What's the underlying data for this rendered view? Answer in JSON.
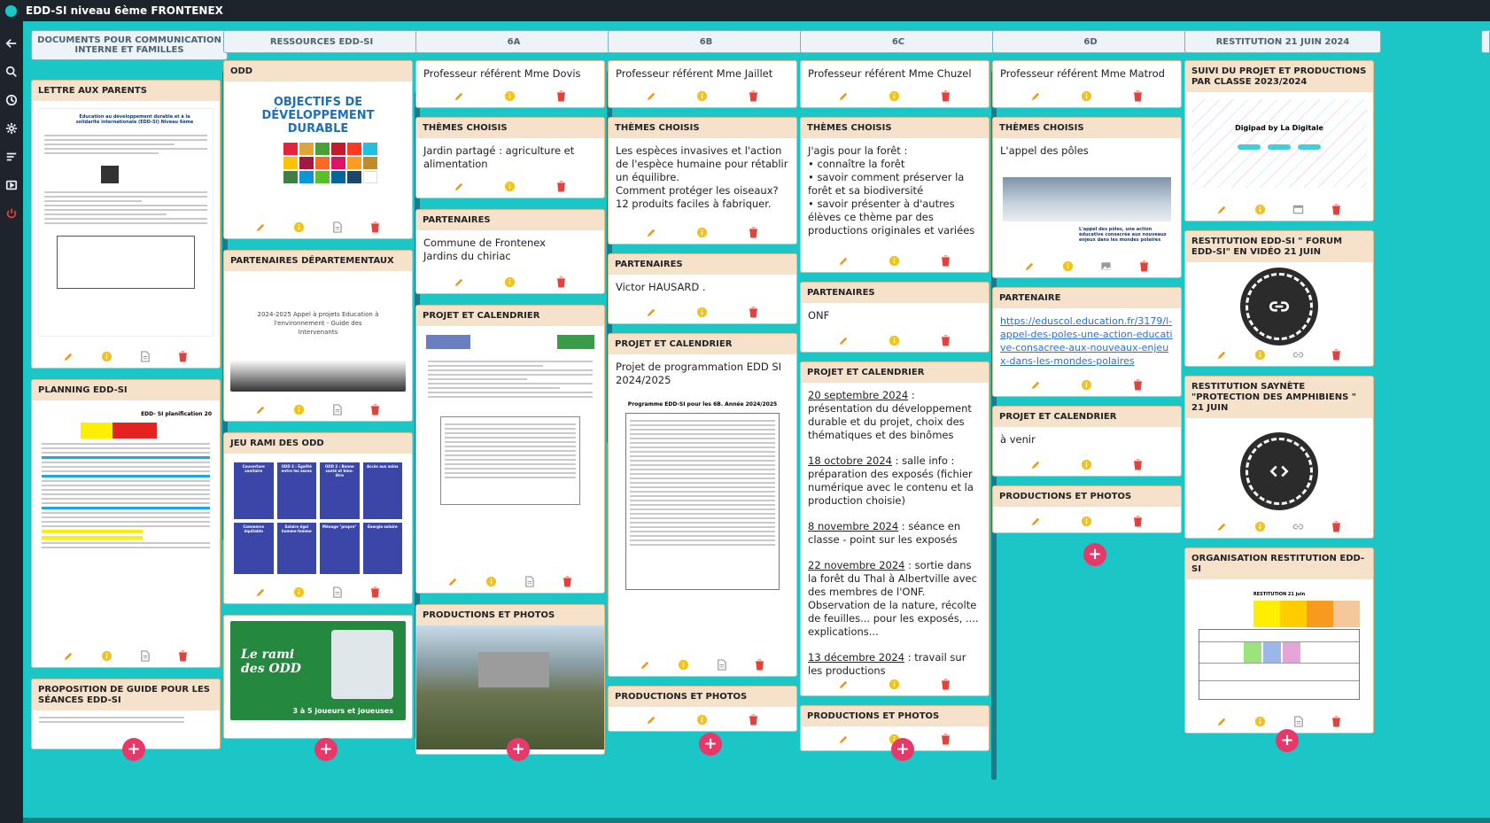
{
  "app": {
    "title": "EDD-SI niveau 6ème FRONTENEX"
  },
  "sidebar": {
    "icons": [
      "arrow-left-icon",
      "search-icon",
      "clock-icon",
      "gear-icon",
      "menu-icon",
      "slideshow-icon",
      "power-icon"
    ]
  },
  "columns": [
    {
      "title": "DOCUMENTS POUR COMMUNICATION INTERNE ET FAMILLES",
      "cards": [
        {
          "title": "LETTRE AUX PARENTS",
          "thumb_caption": "Education au développement durable et à la solidarité internationale (EDD-SI) Niveau 6ème"
        },
        {
          "title": "PLANNING EDD-SI",
          "thumb_caption": "EDD- SI planification 20"
        },
        {
          "title": "PROPOSITION DE GUIDE POUR LES SÉANCES EDD-SI"
        }
      ]
    },
    {
      "title": "RESSOURCES EDD-SI",
      "cards": [
        {
          "title": "ODD",
          "thumb_caption": "OBJECTIFS DE DÉVELOPPEMENT DURABLE"
        },
        {
          "title": "PARTENAIRES DÉPARTEMENTAUX",
          "thumb_caption": "2024-2025 Appel à projets Education à l'environnement - Guide des Intervenants"
        },
        {
          "title": "JEU RAMI DES ODD",
          "tiles": [
            "Couverture sanitaire",
            "ODD 3 : Égalité entre les sexes",
            "ODD 3 : Bonne santé et bien-être",
            "Accès aux soins",
            "Commerce équitable",
            "Salaire égal homme-femme",
            "Ménage \"propre\"",
            "Énergie solaire"
          ]
        },
        {
          "title": "",
          "thumb_caption": "Le rami des ODD",
          "thumb_sub": "3 à 5 joueurs et joueuses"
        }
      ]
    },
    {
      "title": "6A",
      "cards": [
        {
          "title": "",
          "text": "Professeur référent Mme Dovis"
        },
        {
          "title": "THÈMES CHOISIS",
          "text": "Jardin partagé : agriculture et alimentation"
        },
        {
          "title": "PARTENAIRES",
          "text": "Commune de Frontenex\nJardins du chiriac"
        },
        {
          "title": "PROJET ET CALENDRIER"
        },
        {
          "title": "PRODUCTIONS ET PHOTOS"
        }
      ]
    },
    {
      "title": "6B",
      "cards": [
        {
          "title": "",
          "text": "Professeur référent Mme Jaillet"
        },
        {
          "title": "THÈMES CHOISIS",
          "text": "Les espèces invasives et l'action de l'espèce humaine pour rétablir un équilibre.\nComment protéger les oiseaux?\n12 produits faciles à fabriquer."
        },
        {
          "title": "PARTENAIRES",
          "text": "Victor HAUSARD ."
        },
        {
          "title": "PROJET ET CALENDRIER",
          "text": "Projet de programmation EDD SI 2024/2025",
          "thumb_caption": "Programme EDD-SI pour les 6B. Année 2024/2025"
        },
        {
          "title": "PRODUCTIONS ET PHOTOS"
        }
      ]
    },
    {
      "title": "6C",
      "cards": [
        {
          "title": "",
          "text": "Professeur référent Mme Chuzel"
        },
        {
          "title": "THÈMES CHOISIS",
          "text": "J'agis pour la forêt :\n• connaître la forêt\n• savoir comment préserver la forêt et sa biodiversité\n• savoir présenter à d'autres élèves ce thème par des productions originales et variées"
        },
        {
          "title": "PARTENAIRES",
          "text": "ONF"
        },
        {
          "title": "PROJET ET CALENDRIER",
          "entries": [
            {
              "date": "20 septembre 2024",
              "text": " : présentation du développement durable et du projet, choix des  thématiques et des binômes"
            },
            {
              "date": "18 octobre 2024",
              "text": " :  salle info : préparation des exposés (fichier numérique avec le contenu et la production choisie)"
            },
            {
              "date": "8 novembre 2024",
              "text": " : séance en classe - point sur les exposés"
            },
            {
              "date": "22 novembre 2024",
              "text": " : sortie dans la forêt du Thal à Albertville avec des membres de l'ONF. Observation de la nature, récolte de feuilles... pour les exposés, .... explications..."
            },
            {
              "date": "13 décembre 2024",
              "text": " : travail sur les productions"
            }
          ]
        },
        {
          "title": "PRODUCTIONS ET PHOTOS"
        }
      ]
    },
    {
      "title": "6D",
      "cards": [
        {
          "title": "",
          "text": "Professeur référent Mme Matrod"
        },
        {
          "title": "THÈMES CHOISIS",
          "text": "L'appel des pôles",
          "thumb_caption": "L'appel des pôles, une action éducative consacrée aux nouveaux enjeux dans les mondes polaires"
        },
        {
          "title": "PARTENAIRE",
          "link": "https://eduscol.education.fr/3179/l-appel-des-poles-une-action-educative-consacree-aux-nouveaux-enjeux-dans-les-mondes-polaires"
        },
        {
          "title": "PROJET ET CALENDRIER",
          "text": "à venir"
        },
        {
          "title": "PRODUCTIONS ET PHOTOS"
        }
      ]
    },
    {
      "title": "RESTITUTION 21 JUIN 2024",
      "cards": [
        {
          "title": "SUIVI DU PROJET ET PRODUCTIONS PAR CLASSE 2023/2024",
          "thumb_caption": "Digipad by La Digitale"
        },
        {
          "title": "RESTITUTION EDD-SI \" FORUM EDD-SI\" EN VIDÉO 21 JUIN"
        },
        {
          "title": "RESTITUTION SAYNÈTE \"PROTECTION DES AMPHIBIENS \" 21 JUIN"
        },
        {
          "title": "ORGANISATION RESTITUTION EDD-SI",
          "thumb_caption": "RESTITUTION 21 juin"
        }
      ]
    }
  ],
  "colors": {
    "bg": "#1bc6c6",
    "edit": "#e79a1f",
    "info": "#f3c21b",
    "delete": "#e3413b",
    "add": "#e8386a",
    "card_header": "#f6e1cb"
  }
}
